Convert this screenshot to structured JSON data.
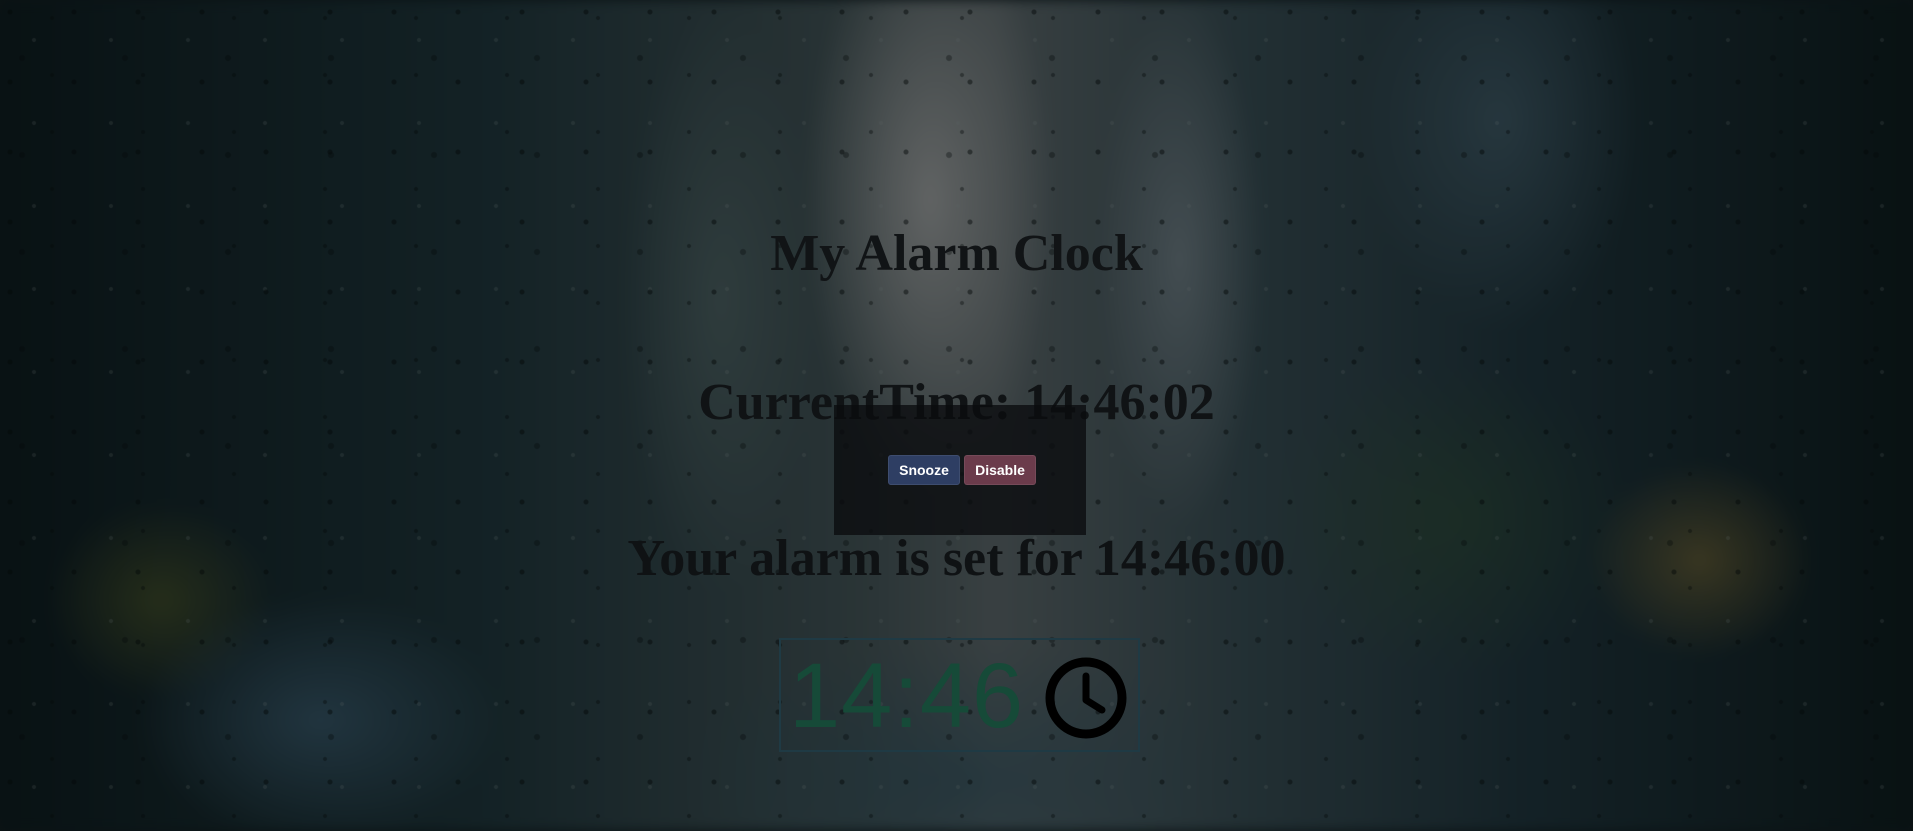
{
  "page": {
    "title": "My Alarm Clock",
    "current_time_label": "CurrentTime: 14:46:02",
    "alarm_set_label": "Your alarm is set for 14:46:00"
  },
  "digital_clock": {
    "time": "14:46",
    "icon": "clock-icon",
    "digit_color": "#164a38"
  },
  "alarm_modal": {
    "snooze_label": "Snooze",
    "disable_label": "Disable",
    "snooze_color": "#2e3e63",
    "disable_color": "#6b3b4b"
  },
  "background": {
    "description_icon": "rain-window-photo",
    "overlay_color": "#000000"
  }
}
